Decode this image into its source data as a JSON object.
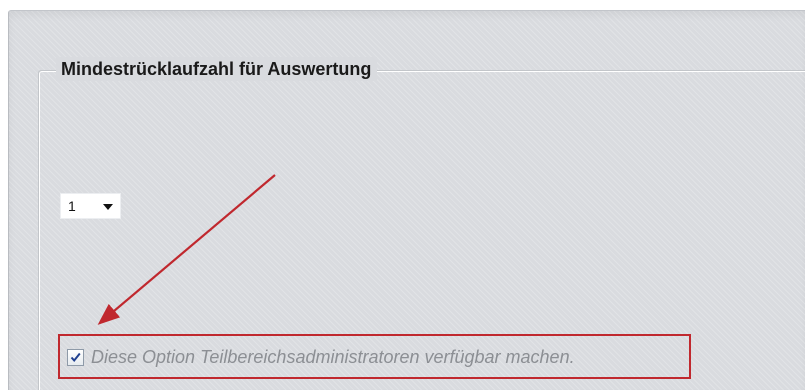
{
  "section": {
    "legend": "Mindestrücklaufzahl für Auswertung"
  },
  "select": {
    "value": "1"
  },
  "option": {
    "checked": true,
    "label": "Diese Option Teilbereichsadministratoren verfügbar machen."
  },
  "annotation": {
    "arrow_color": "#c0282e",
    "box_color": "#c0282e"
  },
  "icons": {
    "dropdown": "chevron-down-icon",
    "checkbox": "checkmark-icon"
  }
}
